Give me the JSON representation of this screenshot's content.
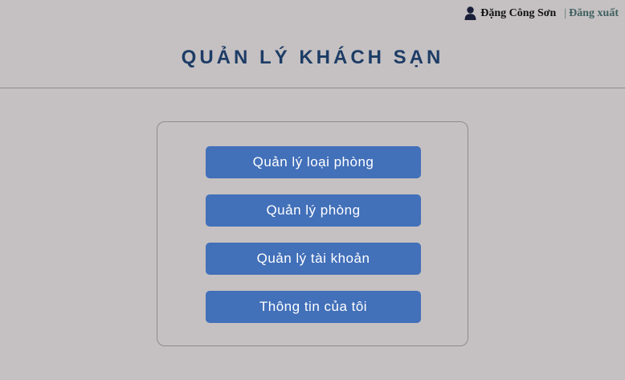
{
  "header": {
    "user_icon": "user-icon",
    "user_name": "Đặng Công Sơn",
    "separator": "|",
    "logout_label": "Đăng xuất"
  },
  "page": {
    "title": "QUẢN LÝ KHÁCH SẠN"
  },
  "menu": {
    "items": [
      {
        "label": "Quản lý loại phòng"
      },
      {
        "label": "Quản lý phòng"
      },
      {
        "label": "Quản lý tài khoản"
      },
      {
        "label": "Thông tin của tôi"
      }
    ]
  },
  "colors": {
    "background": "#c5c1c2",
    "title": "#1d3c66",
    "button": "#4270b9",
    "button_text": "#ffffff",
    "logout": "#3f5f5f"
  }
}
